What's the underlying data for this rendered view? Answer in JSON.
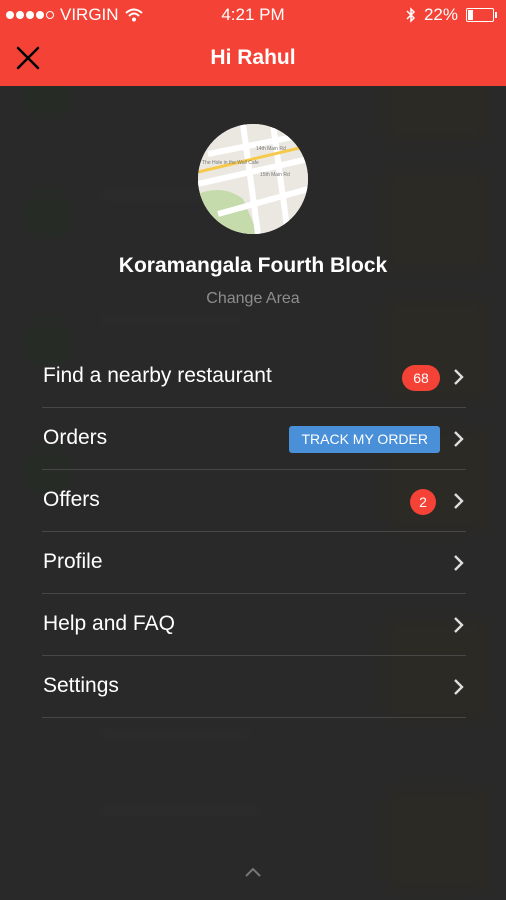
{
  "status_bar": {
    "carrier": "VIRGIN",
    "time": "4:21 PM",
    "battery": "22%",
    "battery_level": 0.22
  },
  "header": {
    "title": "Hi Rahul",
    "color": "#f44336"
  },
  "location": {
    "area_name": "Koramangala Fourth Block",
    "change_label": "Change Area"
  },
  "menu": {
    "find": {
      "label": "Find a nearby restaurant",
      "badge": "68"
    },
    "orders": {
      "label": "Orders",
      "action": "TRACK MY ORDER"
    },
    "offers": {
      "label": "Offers",
      "badge": "2"
    },
    "profile": {
      "label": "Profile"
    },
    "help": {
      "label": "Help and FAQ"
    },
    "settings": {
      "label": "Settings"
    }
  },
  "colors": {
    "accent": "#f44336",
    "track_button": "#4a90d9",
    "overlay": "#2a2a2a"
  }
}
